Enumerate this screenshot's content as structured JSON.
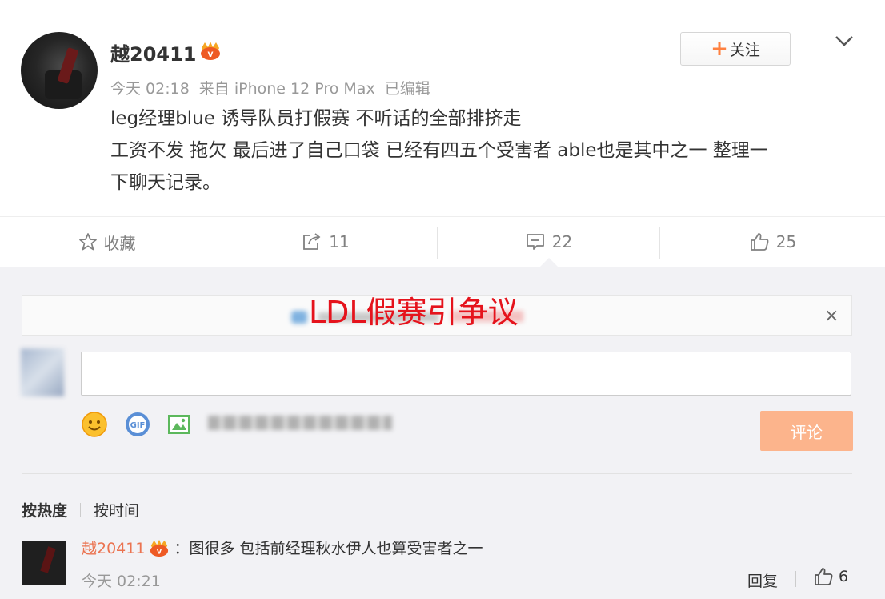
{
  "post": {
    "author": "越20411",
    "follow_label": "关注",
    "time": "今天 02:18",
    "source": "来自 iPhone 12 Pro Max",
    "edited": "已编辑",
    "content": [
      "leg经理blue 诱导队员打假赛 不听话的全部排挤走",
      "工资不发 拖欠 最后进了自己口袋 已经有四五个受害者 able也是其中之一 整理一",
      "下聊天记录。"
    ]
  },
  "actions": {
    "favorite_label": "收藏",
    "forward_count": "11",
    "comment_count": "22",
    "like_count": "25"
  },
  "overlay_title": "LDL假赛引争议",
  "comment_box": {
    "placeholder": "",
    "submit_label": "评论"
  },
  "sort": {
    "by_hot": "按热度",
    "by_time": "按时间"
  },
  "comment": {
    "author": "越20411",
    "text": "：图很多 包括前经理秋水伊人也算受害者之一",
    "time": "今天 02:21",
    "reply_label": "回复",
    "like_count": "6"
  },
  "colors": {
    "accent_orange": "#ff8140",
    "submit_bg": "#fcb48c",
    "commenter_name": "#eb7350",
    "overlay_red": "#e5131c"
  }
}
